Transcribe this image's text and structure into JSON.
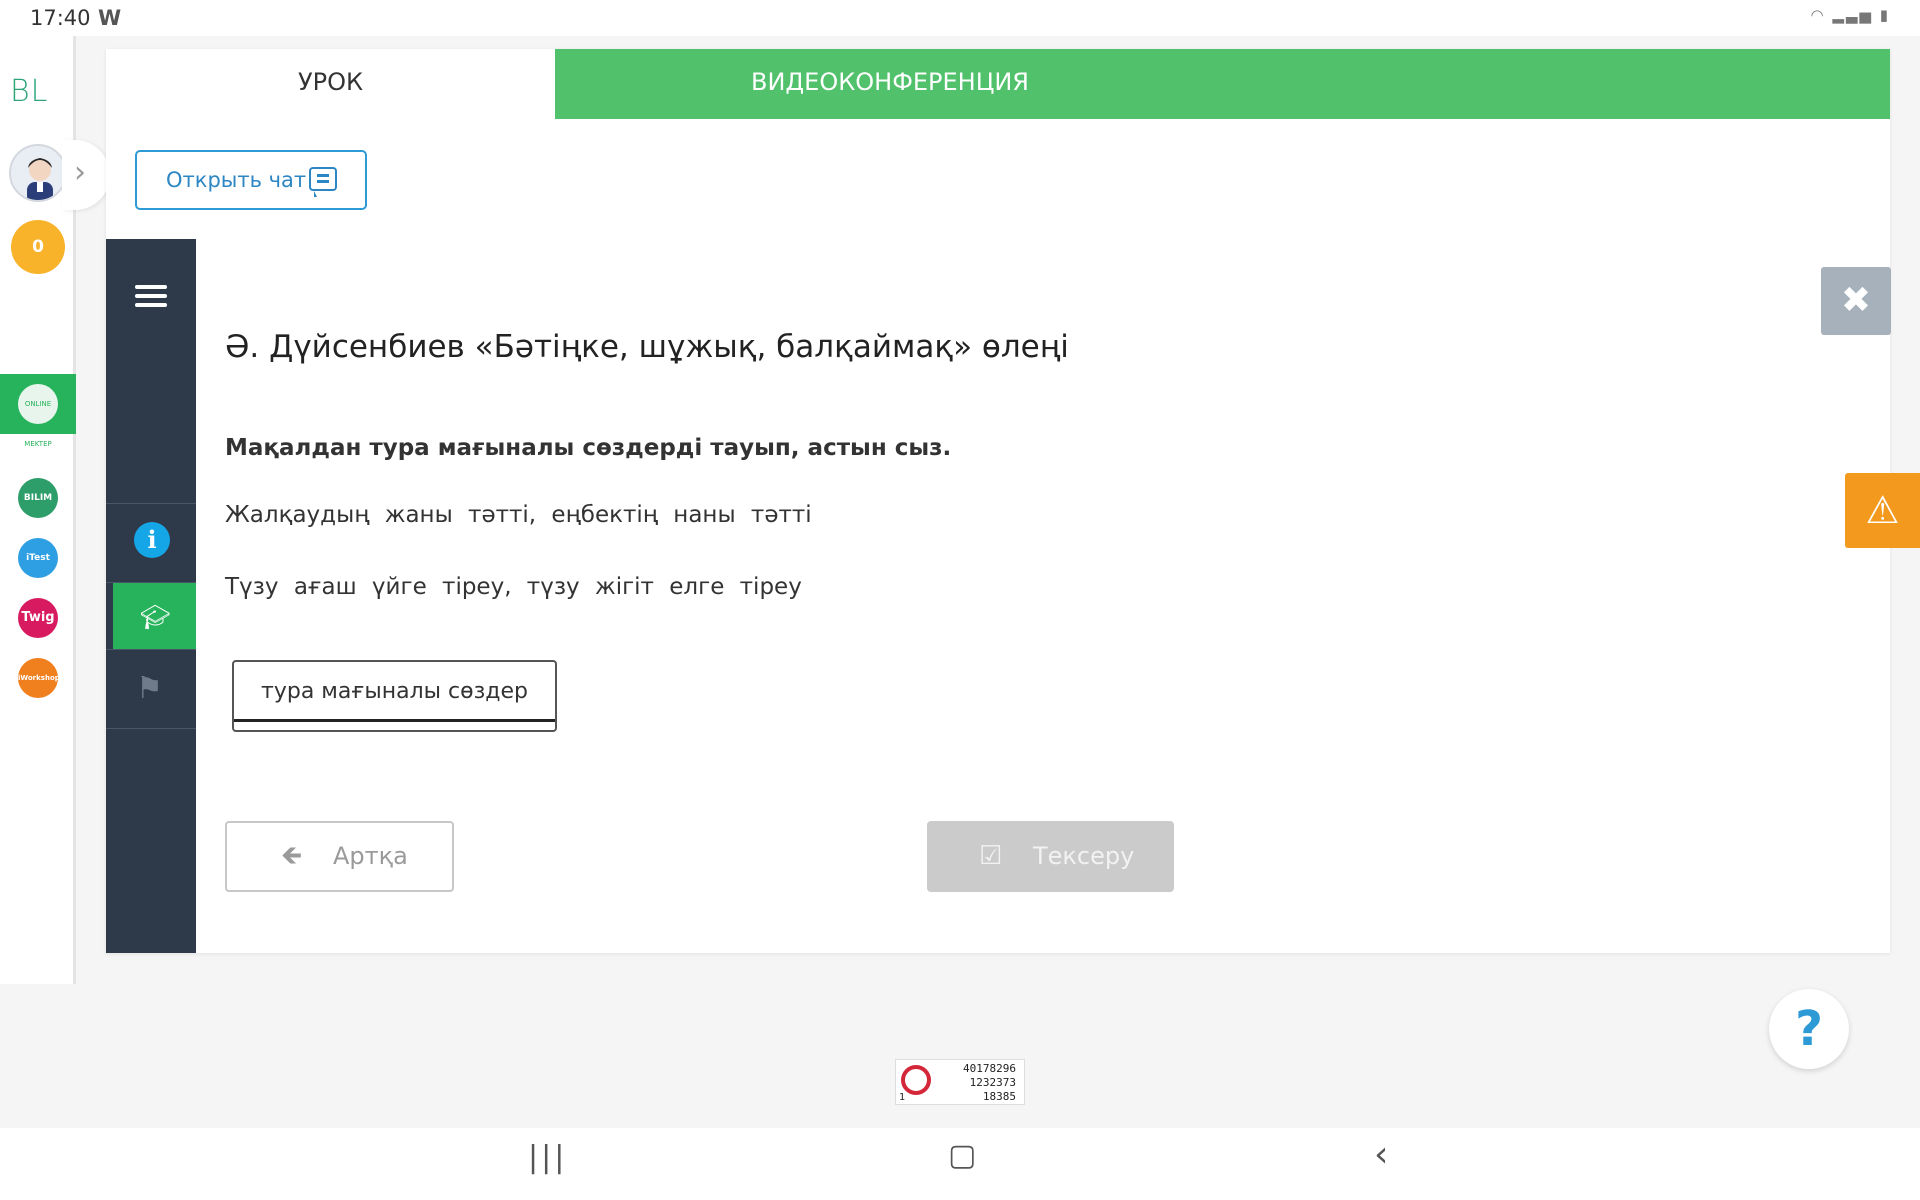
{
  "statusbar": {
    "time": "17:40",
    "app_icon": "W"
  },
  "sidebar": {
    "logo": "BL",
    "coins": "0",
    "apps": [
      {
        "name": "online-mektep",
        "label": "ONLINE MEKTEP",
        "color": "#27b35b"
      },
      {
        "name": "bilim-land",
        "label": "BILIM Land",
        "color": "#2d9e6a"
      },
      {
        "name": "itest",
        "label": "iTest",
        "color": "#2f9fe3"
      },
      {
        "name": "twig",
        "label": "Twig",
        "color": "#d81b60"
      },
      {
        "name": "iworkshop",
        "label": "iWorkshop",
        "color": "#f07f1e"
      }
    ]
  },
  "tabs": {
    "lesson": "УРОК",
    "video": "ВИДЕОКОНФЕРЕНЦИЯ"
  },
  "chat": {
    "label": "Открыть чат"
  },
  "lesson": {
    "title": "Ә. Дүйсенбиев «Бәтіңке, шұжық, балқаймақ» өлеңі",
    "instruction": "Мақалдан тура мағыналы сөздерді тауып, астын сыз.",
    "proverbs": [
      "Жалқаудың жаны тәтті, еңбектің наны тәтті",
      "Түзу ағаш үйге тіреу, түзу жігіт елге тіреу"
    ],
    "answer_label": "тура мағыналы сөздер"
  },
  "buttons": {
    "back": "Артқа",
    "check": "Тексеру"
  },
  "widget": {
    "line1": "40178296",
    "line2": "1232373",
    "line3": "18385",
    "corner": "1"
  },
  "colors": {
    "green": "#51c16b",
    "accent_blue": "#2d9ad6",
    "dark_nav": "#2e3a4a",
    "warning": "#f39a1e"
  }
}
